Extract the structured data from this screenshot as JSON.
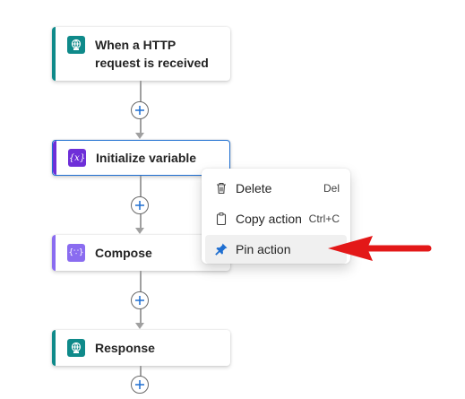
{
  "flow": {
    "steps": [
      {
        "title": "When a HTTP request is received",
        "icon": "http-request-icon",
        "accent": "#0f8a8a"
      },
      {
        "title": "Initialize variable",
        "icon": "variable-icon",
        "accent": "#6e2fd8"
      },
      {
        "title": "Compose",
        "icon": "compose-icon",
        "accent": "#8a6cf0"
      },
      {
        "title": "Response",
        "icon": "http-response-icon",
        "accent": "#0f8a8a"
      }
    ]
  },
  "context_menu": {
    "items": [
      {
        "label": "Delete",
        "shortcut": "Del",
        "icon": "trash-icon"
      },
      {
        "label": "Copy action",
        "shortcut": "Ctrl+C",
        "icon": "clipboard-icon"
      },
      {
        "label": "Pin action",
        "shortcut": "",
        "icon": "pin-icon"
      }
    ]
  },
  "colors": {
    "selected_border": "#1f6fd1",
    "pointer_arrow": "#e31818",
    "menu_hover": "#f0f0f0"
  }
}
